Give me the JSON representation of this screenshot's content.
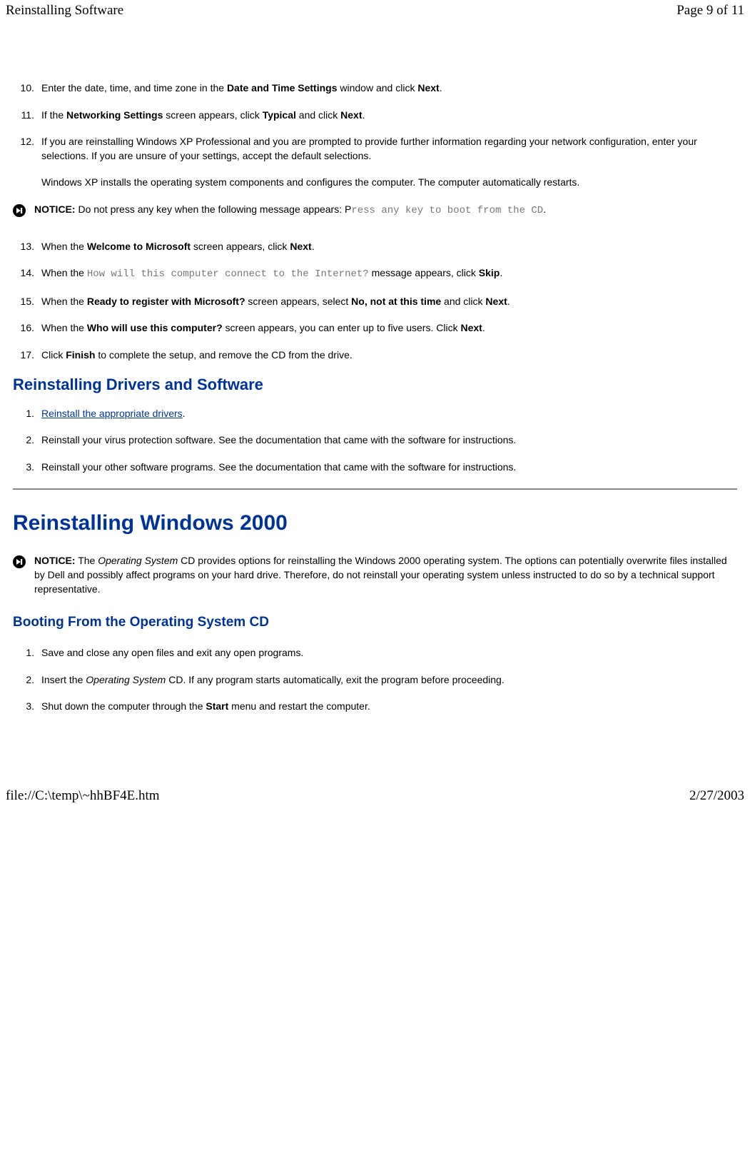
{
  "header": {
    "title": "Reinstalling Software",
    "pageinfo": "Page 9 of 11"
  },
  "steps_a": {
    "n10": "10.",
    "t10_pre": "Enter the date, time, and time zone in the ",
    "t10_b1": "Date and Time Settings",
    "t10_mid": " window and click ",
    "t10_b2": "Next",
    "t10_post": ".",
    "n11": "11.",
    "t11_pre": "If the ",
    "t11_b1": "Networking Settings",
    "t11_mid": " screen appears, click ",
    "t11_b2": "Typical",
    "t11_mid2": " and click ",
    "t11_b3": "Next",
    "t11_post": ".",
    "n12": "12.",
    "t12": "If you are reinstalling Windows XP Professional and you are prompted to provide further information regarding your network configuration, enter your selections. If you are unsure of your settings, accept the default selections."
  },
  "para1": "Windows XP installs the operating system components and configures the computer. The computer automatically restarts.",
  "notice1": {
    "label": "NOTICE:",
    "pre": " Do not press any key when the following message appears: P",
    "mono": "ress any key to boot from the CD",
    "post": "."
  },
  "steps_b": {
    "n13": "13.",
    "t13_pre": "When the ",
    "t13_b1": "Welcome to Microsoft",
    "t13_mid": " screen appears, click ",
    "t13_b2": "Next",
    "t13_post": ".",
    "n14": "14.",
    "t14_pre": "When the ",
    "t14_mono": "How will this computer connect to the Internet?",
    "t14_mid": " message appears, click ",
    "t14_b1": "Skip",
    "t14_post": ".",
    "n15": "15.",
    "t15_pre": "When the ",
    "t15_b1": "Ready to register with Microsoft?",
    "t15_mid": " screen appears, select ",
    "t15_b2": "No, not at this time",
    "t15_mid2": " and click ",
    "t15_b3": "Next",
    "t15_post": ".",
    "n16": "16.",
    "t16_pre": "When the ",
    "t16_b1": "Who will use this computer?",
    "t16_mid": " screen appears, you can enter up to five users. Click ",
    "t16_b2": "Next",
    "t16_post": ".",
    "n17": "17.",
    "t17_pre": "Click ",
    "t17_b1": "Finish",
    "t17_post": " to complete the setup, and remove the CD from the drive."
  },
  "h2_drivers": "Reinstalling Drivers and Software",
  "steps_c": {
    "n1": "1.",
    "t1_link": "Reinstall the appropriate drivers",
    "t1_post": ".",
    "n2": "2.",
    "t2": "Reinstall your virus protection software. See the documentation that came with the software for instructions.",
    "n3": "3.",
    "t3": "Reinstall your other software programs. See the documentation that came with the software for instructions."
  },
  "h1_win2000": "Reinstalling Windows 2000",
  "notice2": {
    "label": "NOTICE:",
    "pre": " The ",
    "em": "Operating System",
    "post": " CD provides options for reinstalling the Windows 2000 operating system. The options can potentially overwrite files installed by Dell and possibly affect programs on your hard drive. Therefore, do not reinstall your operating system unless instructed to do so by a technical support representative."
  },
  "h3_boot": "Booting From the Operating System CD",
  "steps_d": {
    "n1": "1.",
    "t1": "Save and close any open files and exit any open programs.",
    "n2": "2.",
    "t2_pre": "Insert the ",
    "t2_em": "Operating System",
    "t2_post": " CD. If any program starts automatically, exit the program before proceeding.",
    "n3": "3.",
    "t3_pre": "Shut down the computer through the ",
    "t3_b1": "Start",
    "t3_post": " menu and restart the computer."
  },
  "footer": {
    "path": "file://C:\\temp\\~hhBF4E.htm",
    "date": "2/27/2003"
  }
}
